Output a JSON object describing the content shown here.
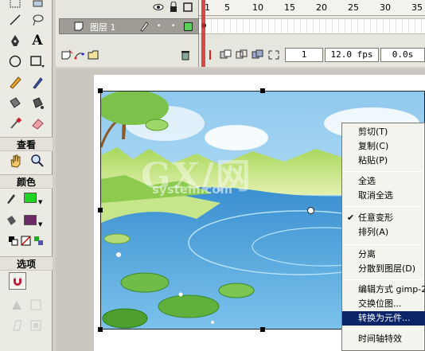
{
  "tools": {
    "view_label": "查看",
    "colors_label": "颜色",
    "options_label": "选项",
    "stroke_color": "#22d422",
    "fill_color": "#6b2a66",
    "items": [
      "arrow-tool",
      "subselect-tool",
      "line-tool",
      "lasso-tool",
      "pen-tool",
      "text-tool",
      "oval-tool",
      "rectangle-tool",
      "pencil-tool",
      "brush-tool",
      "ink-bottle-tool",
      "paint-bucket-tool",
      "eyedropper-tool",
      "eraser-tool",
      "hand-tool",
      "zoom-tool"
    ],
    "text_tool_glyph": "A"
  },
  "timeline": {
    "layer_name": "图层 1",
    "frame_numbers": [
      "1",
      "5",
      "10",
      "15",
      "20",
      "25",
      "30",
      "35"
    ],
    "current_frame": "1",
    "frame_rate": "12.0 fps",
    "elapsed_time": "0.0s"
  },
  "context_menu": {
    "items": [
      {
        "label": "剪切(T)",
        "checked": false,
        "selected": false
      },
      {
        "label": "复制(C)",
        "checked": false,
        "selected": false
      },
      {
        "label": "粘贴(P)",
        "checked": false,
        "selected": false
      },
      {
        "label": "全选",
        "checked": false,
        "selected": false
      },
      {
        "label": "取消全选",
        "checked": false,
        "selected": false
      },
      {
        "label": "任意变形",
        "checked": true,
        "selected": false
      },
      {
        "label": "排列(A)",
        "checked": false,
        "selected": false
      },
      {
        "label": "分离",
        "checked": false,
        "selected": false
      },
      {
        "label": "分散到图层(D)",
        "checked": false,
        "selected": false
      },
      {
        "label": "编辑方式 gimp-2",
        "checked": false,
        "selected": false
      },
      {
        "label": "交换位图...",
        "checked": false,
        "selected": false
      },
      {
        "label": "转换为元件...",
        "checked": false,
        "selected": true
      },
      {
        "label": "时间轴特效",
        "checked": false,
        "selected": false
      }
    ],
    "checkmark_glyph": "✔"
  },
  "watermark": {
    "big": "GX/网",
    "small": "system.com"
  }
}
